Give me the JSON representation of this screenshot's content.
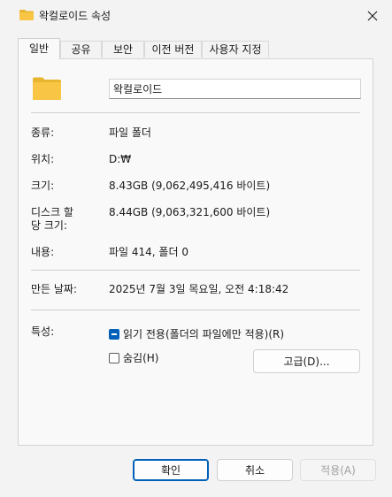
{
  "window": {
    "title": "왁컬로이드 속성"
  },
  "tabs": [
    {
      "label": "일반",
      "active": true
    },
    {
      "label": "공유",
      "active": false
    },
    {
      "label": "보안",
      "active": false
    },
    {
      "label": "이전 버전",
      "active": false
    },
    {
      "label": "사용자 지정",
      "active": false
    }
  ],
  "general": {
    "name_value": "왁컬로이드",
    "fields": {
      "type": {
        "label": "종류:",
        "value": "파일 폴더"
      },
      "location": {
        "label": "위치:",
        "value": "D:₩"
      },
      "size": {
        "label": "크기:",
        "value": "8.43GB (9,062,495,416 바이트)"
      },
      "disk_size": {
        "label_line1": "디스크 할",
        "label_line2": "당 크기:",
        "value": "8.44GB (9,063,321,600 바이트)"
      },
      "contents": {
        "label": "내용:",
        "value": "파일 414, 폴더 0"
      },
      "created": {
        "label": "만든 날짜:",
        "value": "2025년 7월 3일 목요일, 오전 4:18:42"
      }
    },
    "attributes": {
      "label": "특성:",
      "readonly_label": "읽기 전용(폴더의 파일에만 적용)(R)",
      "readonly_state": "indeterminate",
      "hidden_label": "숨김(H)",
      "hidden_state": "unchecked",
      "advanced_button": "고급(D)..."
    }
  },
  "footer": {
    "ok": "확인",
    "cancel": "취소",
    "apply": "적용(A)"
  },
  "colors": {
    "accent": "#005fb8",
    "folder": "#f8c545"
  },
  "icons": {
    "title": "folder-icon",
    "close": "close-icon",
    "large": "folder-icon"
  }
}
